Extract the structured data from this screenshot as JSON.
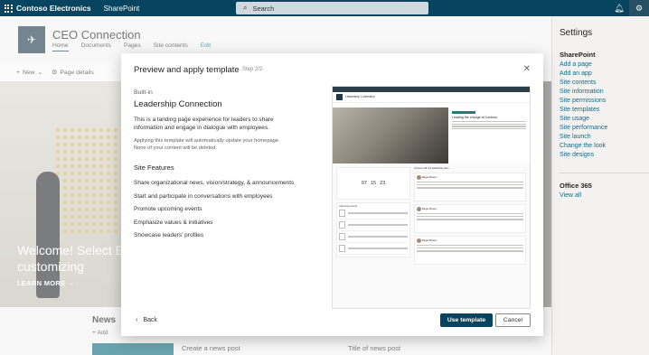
{
  "suite": {
    "brand": "Contoso Electronics",
    "app": "SharePoint",
    "search_placeholder": "Search"
  },
  "site": {
    "title": "CEO Connection",
    "nav": [
      "Home",
      "Documents",
      "Pages",
      "Site contents",
      "Edit"
    ],
    "command": {
      "new_label": "New",
      "page_details_label": "Page details"
    }
  },
  "hero": {
    "headline_line1": "Welcome! Select Ed",
    "headline_line2": "customizing",
    "learn_more": "LEARN MORE →"
  },
  "news": {
    "title": "News",
    "add_label": "Add",
    "create_post": "Create a news post",
    "title_of_post": "Title of news post"
  },
  "settings": {
    "title": "Settings",
    "sharepoint_title": "SharePoint",
    "sharepoint_links": [
      "Add a page",
      "Add an app",
      "Site contents",
      "Site information",
      "Site permissions",
      "Site templates",
      "Site usage",
      "Site performance",
      "Site launch",
      "Change the look",
      "Site designs"
    ],
    "office_title": "Office 365",
    "office_links": [
      "View all"
    ]
  },
  "dialog": {
    "title": "Preview and apply template",
    "step": "Step 2/2",
    "builtin": "Built-in",
    "template_name": "Leadership Connection",
    "description": "This is a landing page experience for leaders to share information and engage in dialogue with employees.",
    "warning": "Applying this template will automatically update your homepage. None of your content will be deleted.",
    "features_title": "Site Features",
    "features": [
      "Share organizational news, vision/strategy, & announcements",
      "Start and participate in conversations with employees",
      "Promote upcoming events",
      "Emphasize values & initiatives",
      "Showcase leaders' profiles"
    ],
    "back_label": "Back",
    "use_label": "Use template",
    "cancel_label": "Cancel"
  },
  "preview": {
    "site_title": "Leadership Connection",
    "hero_heading": "Leading the change at Contoso",
    "countdown": [
      "07",
      "15",
      "23"
    ],
    "events_title": "Upcoming events",
    "conversations_title": "Connect with the leadership team",
    "poster_name": "Megan Bowen"
  },
  "icons": {
    "waffle": "waffle-icon",
    "search": "search-icon",
    "bell": "bell-icon",
    "gear": "gear-icon",
    "close": "close-icon",
    "back": "chevron-left-icon"
  },
  "colors": {
    "suite_bar": "#06445f",
    "accent": "#06445f",
    "link": "#0f6b8c"
  }
}
